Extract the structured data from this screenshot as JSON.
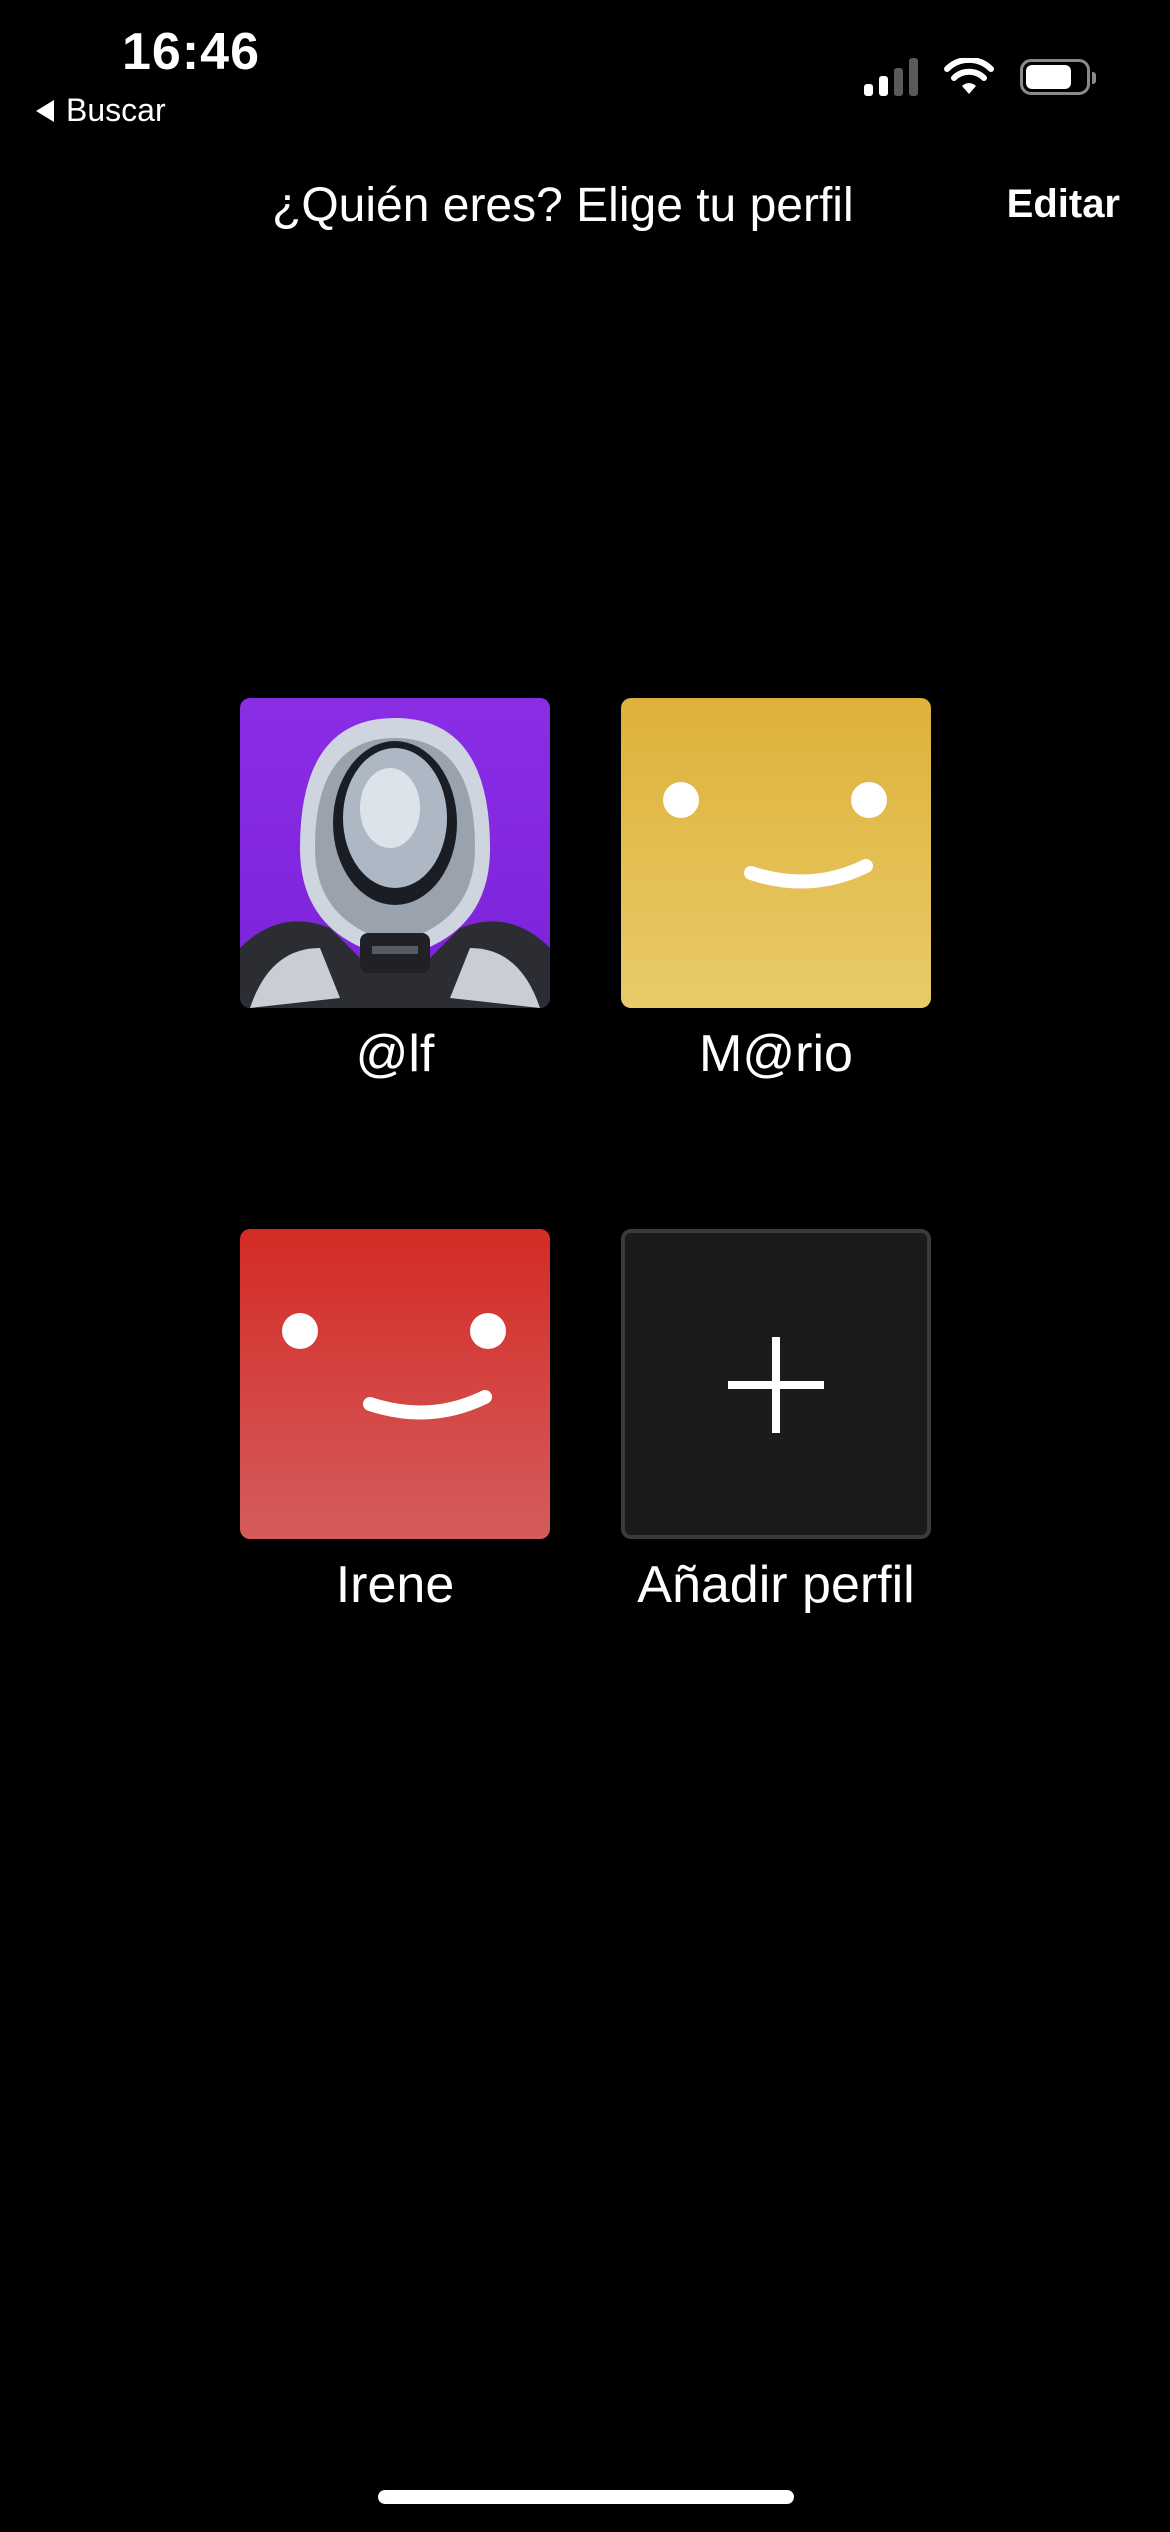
{
  "status_bar": {
    "time": "16:46",
    "back_app_label": "Buscar",
    "signal_icon": "cellular-signal-icon",
    "wifi_icon": "wifi-icon",
    "battery_icon": "battery-icon",
    "battery_level": 0.78
  },
  "header": {
    "title": "¿Quién eres? Elige tu perfil",
    "edit_label": "Editar"
  },
  "profiles": [
    {
      "name": "@lf",
      "avatar": "astronaut-avatar",
      "color": "#7b22d9"
    },
    {
      "name": "M@rio",
      "avatar": "smiley-avatar",
      "color": "#e0b43f"
    },
    {
      "name": "Irene",
      "avatar": "smiley-avatar",
      "color": "#d42b26"
    },
    {
      "name": "Añadir perfil",
      "avatar": "plus-icon",
      "color": "#1b1b1b"
    }
  ],
  "colors": {
    "background": "#000000",
    "text": "#ffffff"
  }
}
